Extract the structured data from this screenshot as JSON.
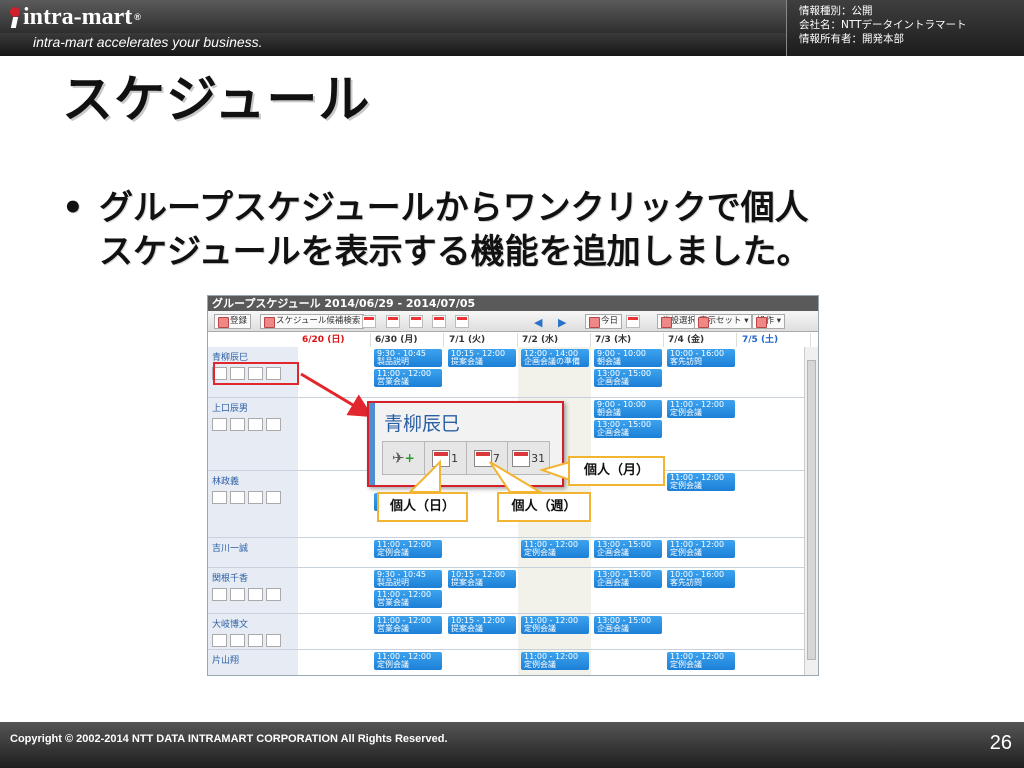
{
  "brand": {
    "logo_text": "intra-mart",
    "logo_reg": "®",
    "tagline": "intra-mart accelerates your business."
  },
  "info": {
    "line1": "情報種別：公開",
    "line2": "会社名：NTTデータイントラマート",
    "line3": "情報所有者：開発本部"
  },
  "title": "スケジュール",
  "bullet": {
    "marker": "•",
    "line1": "グループスケジュールからワンクリックで個人",
    "line2": "スケジュールを表示する機能を追加しました。"
  },
  "screenshot": {
    "header": "グループスケジュール 2014/06/29 - 2014/07/05",
    "toolbar": {
      "register": "登録",
      "search": "スケジュール候補検索",
      "today": "今日",
      "facility": "施設選択",
      "display_set": "表示セット ▾",
      "operation": "操作 ▾"
    },
    "days": [
      {
        "label": "6/20 (日)",
        "style": "red"
      },
      {
        "label": "6/30 (月)",
        "style": "gray"
      },
      {
        "label": "7/1 (火)",
        "style": "gray"
      },
      {
        "label": "7/2 (水)",
        "style": "gray"
      },
      {
        "label": "7/3 (木)",
        "style": "gray"
      },
      {
        "label": "7/4 (金)",
        "style": "gray"
      },
      {
        "label": "7/5 (土)",
        "style": "blue"
      }
    ],
    "users": [
      "青柳辰巳",
      "上口辰男",
      "林政義",
      "吉川一誠",
      "関根千香",
      "大岐博文",
      "片山翔"
    ],
    "events": [
      {
        "row": 0,
        "col": 1,
        "time": "9:30 - 10:45",
        "title": "製品説明"
      },
      {
        "row": 0,
        "col": 2,
        "time": "10:15 - 12:00",
        "title": "提案会議"
      },
      {
        "row": 0,
        "col": 3,
        "time": "12:00 - 14:00",
        "title": "企画会議の準備"
      },
      {
        "row": 0,
        "col": 4,
        "time": "9:00 - 10:00",
        "title": "朝会議"
      },
      {
        "row": 0,
        "col": 5,
        "time": "10:00 - 16:00",
        "title": "客先訪問"
      },
      {
        "row": 0,
        "col": 1,
        "slot": 1,
        "time": "11:00 - 12:00",
        "title": "営業会議"
      },
      {
        "row": 0,
        "col": 4,
        "slot": 1,
        "time": "13:00 - 15:00",
        "title": "企画会議"
      },
      {
        "row": 1,
        "col": 4,
        "time": "9:00 - 10:00",
        "title": "朝会議"
      },
      {
        "row": 1,
        "col": 5,
        "time": "11:00 - 12:00",
        "title": "定例会議"
      },
      {
        "row": 1,
        "col": 4,
        "slot": 1,
        "time": "13:00 - 15:00",
        "title": "企画会議"
      },
      {
        "row": 2,
        "col": 5,
        "time": "11:00 - 12:00",
        "title": "定例会議"
      },
      {
        "row": 2,
        "col": 1,
        "slot": 1,
        "time": "",
        "title": "定例会議"
      },
      {
        "row": 3,
        "col": 1,
        "time": "11:00 - 12:00",
        "title": "定例会議"
      },
      {
        "row": 3,
        "col": 3,
        "time": "11:00 - 12:00",
        "title": "定例会議"
      },
      {
        "row": 3,
        "col": 4,
        "time": "13:00 - 15:00",
        "title": "企画会議"
      },
      {
        "row": 3,
        "col": 5,
        "time": "11:00 - 12:00",
        "title": "定例会議"
      },
      {
        "row": 4,
        "col": 1,
        "time": "9:30 - 10:45",
        "title": "製品説明"
      },
      {
        "row": 4,
        "col": 2,
        "time": "10:15 - 12:00",
        "title": "提案会議"
      },
      {
        "row": 4,
        "col": 4,
        "time": "13:00 - 15:00",
        "title": "企画会議"
      },
      {
        "row": 4,
        "col": 5,
        "time": "10:00 - 16:00",
        "title": "客先訪問"
      },
      {
        "row": 4,
        "col": 1,
        "slot": 1,
        "time": "11:00 - 12:00",
        "title": "営業会議"
      },
      {
        "row": 5,
        "col": 1,
        "time": "11:00 - 12:00",
        "title": "営業会議"
      },
      {
        "row": 5,
        "col": 2,
        "time": "10:15 - 12:00",
        "title": "提案会議"
      },
      {
        "row": 5,
        "col": 3,
        "time": "11:00 - 12:00",
        "title": "定例会議"
      },
      {
        "row": 5,
        "col": 4,
        "time": "13:00 - 15:00",
        "title": "企画会議"
      },
      {
        "row": 6,
        "col": 1,
        "time": "11:00 - 12:00",
        "title": "定例会議"
      },
      {
        "row": 6,
        "col": 3,
        "time": "11:00 - 12:00",
        "title": "定例会議"
      },
      {
        "row": 6,
        "col": 5,
        "time": "11:00 - 12:00",
        "title": "定例会議"
      }
    ]
  },
  "zoom": {
    "name": "青柳辰巳",
    "day_num": "1",
    "week_num": "7",
    "month_num": "31"
  },
  "callouts": {
    "day": "個人（日）",
    "week": "個人（週）",
    "month": "個人（月）"
  },
  "footer": {
    "copyright": "Copyright © 2002-2014 NTT DATA INTRAMART CORPORATION All Rights Reserved.",
    "page": "26"
  }
}
